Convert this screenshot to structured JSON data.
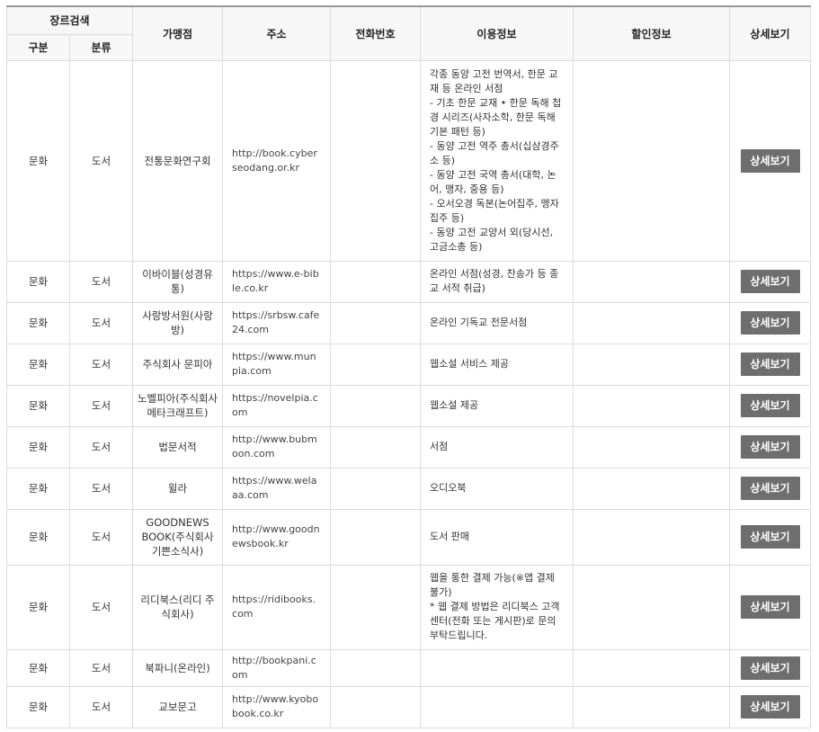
{
  "header": {
    "genre_search": "장르검색",
    "category": "구분",
    "classification": "분류",
    "merchant": "가맹점",
    "address": "주소",
    "phone": "전화번호",
    "usage_info": "이용정보",
    "discount_info": "할인정보",
    "detail": "상세보기"
  },
  "rows": [
    {
      "category": "문화",
      "classification": "도서",
      "merchant": "전통문화연구회",
      "address": "http://book.cyberseodang.or.kr",
      "phone": "",
      "info": [
        "각종 동양 고전 번역서, 한문 교재 등 온라인 서점",
        "- 기초 한문 교재 • 한문 독해 첩경 시리즈(사자소학, 한문 독해 기본 패턴 등)",
        "- 동양 고전 역주 총서(십삼경주소 등)",
        "- 동양 고전 국역 총서(대학, 논어, 맹자, 중용 등)",
        "- 오서오경 독본(논어집주, 맹자집주 등)",
        "- 동양 고전 교양서 외(당시선, 고금소총 등)"
      ],
      "discount": "",
      "button": "상세보기"
    },
    {
      "category": "문화",
      "classification": "도서",
      "merchant": "이바이블(성경유통)",
      "address": "https://www.e-bible.co.kr",
      "phone": "",
      "info": [
        "온라인 서점(성경, 찬송가 등 종교 서적 취급)"
      ],
      "discount": "",
      "button": "상세보기"
    },
    {
      "category": "문화",
      "classification": "도서",
      "merchant": "사랑방서원(사랑방)",
      "address": "https://srbsw.cafe24.com",
      "phone": "",
      "info": [
        "온라인 기독교 전문서점"
      ],
      "discount": "",
      "button": "상세보기"
    },
    {
      "category": "문화",
      "classification": "도서",
      "merchant": "주식회사 문피아",
      "address": "https://www.munpia.com",
      "phone": "",
      "info": [
        "웹소설 서비스 제공"
      ],
      "discount": "",
      "button": "상세보기"
    },
    {
      "category": "문화",
      "classification": "도서",
      "merchant": "노벨피아(주식회사 메타크래프트)",
      "address": "https://novelpia.com",
      "phone": "",
      "info": [
        "웹소설 제공"
      ],
      "discount": "",
      "button": "상세보기"
    },
    {
      "category": "문화",
      "classification": "도서",
      "merchant": "법문서적",
      "address": "http://www.bubmoon.com",
      "phone": "",
      "info": [
        "서점"
      ],
      "discount": "",
      "button": "상세보기"
    },
    {
      "category": "문화",
      "classification": "도서",
      "merchant": "윌라",
      "address": "https://www.welaaa.com",
      "phone": "",
      "info": [
        "오디오북"
      ],
      "discount": "",
      "button": "상세보기"
    },
    {
      "category": "문화",
      "classification": "도서",
      "merchant": "GOODNEWS BOOK(주식회사 기쁜소식사)",
      "address": "http://www.goodnewsbook.kr",
      "phone": "",
      "info": [
        "도서 판매"
      ],
      "discount": "",
      "button": "상세보기"
    },
    {
      "category": "문화",
      "classification": "도서",
      "merchant": "리디북스(리디 주식회사)",
      "address": "https://ridibooks.com",
      "phone": "",
      "info": [
        "웹을 통한 결제 가능(※앱 결제 불가)",
        "* 웹 결제 방법은 리디북스 고객센터(전화 또는 게시판)로 문의 부탁드립니다."
      ],
      "discount": "",
      "button": "상세보기"
    },
    {
      "category": "문화",
      "classification": "도서",
      "merchant": "북파니(온라인)",
      "address": "http://bookpani.com",
      "phone": "",
      "info": [],
      "discount": "",
      "button": "상세보기"
    },
    {
      "category": "문화",
      "classification": "도서",
      "merchant": "교보문고",
      "address": "http://www.kyobobook.co.kr",
      "phone": "",
      "info": [],
      "discount": "",
      "button": "상세보기"
    }
  ]
}
